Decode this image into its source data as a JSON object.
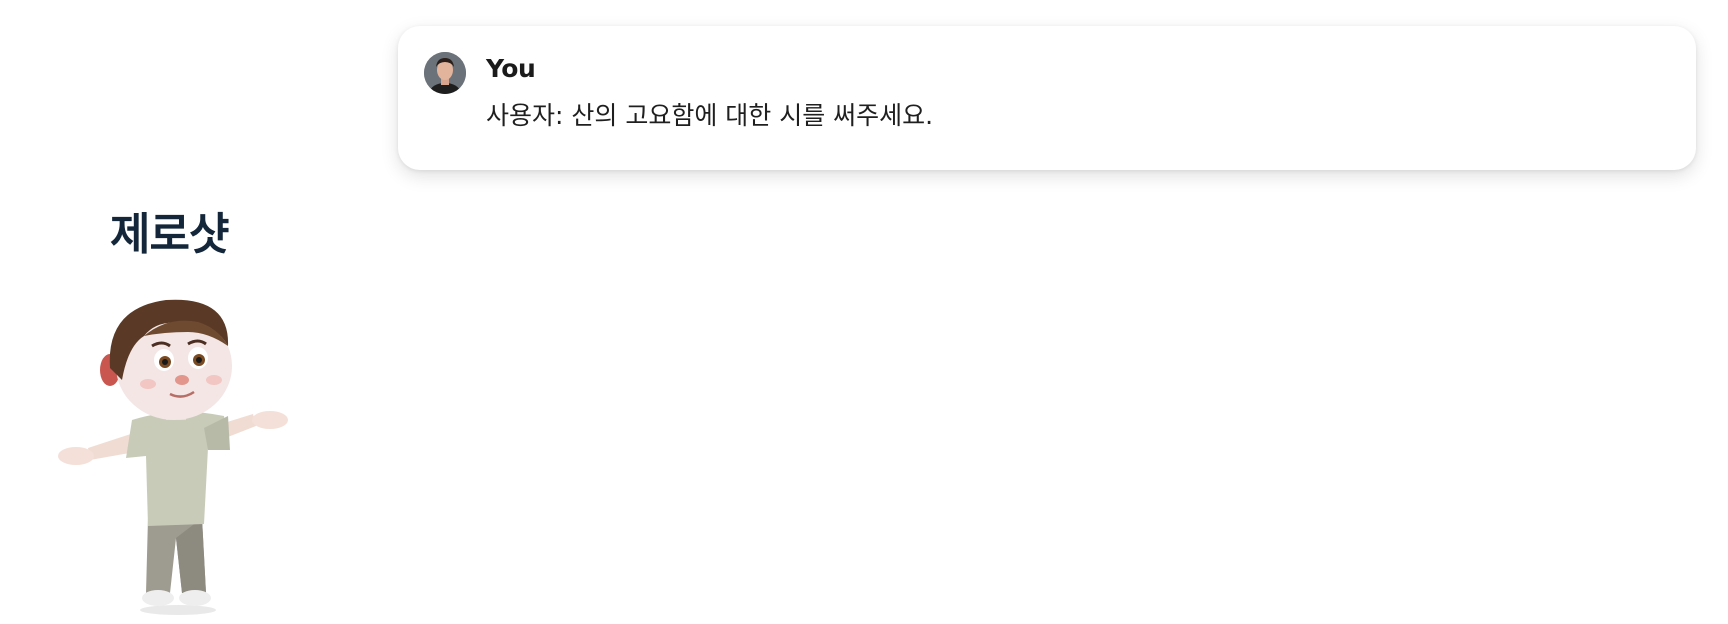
{
  "chat": {
    "author": "You",
    "message": "사용자: 산의 고요함에 대한 시를 써주세요."
  },
  "section": {
    "label": "제로샷"
  },
  "icons": {
    "avatar": "user-avatar-photo",
    "character": "cartoon-boy-illustration"
  }
}
